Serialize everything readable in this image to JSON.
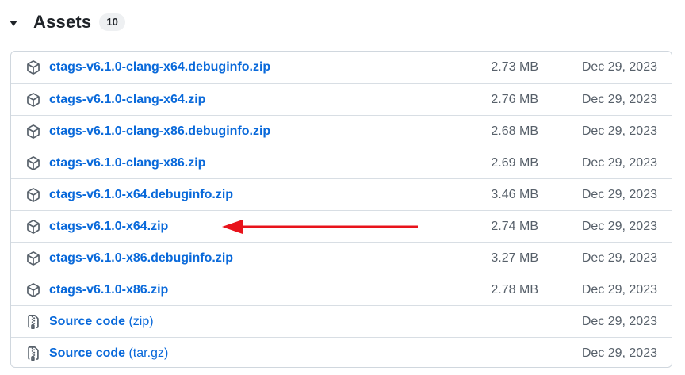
{
  "header": {
    "title": "Assets",
    "count": "10"
  },
  "assets": [
    {
      "name": "ctags-v6.1.0-clang-x64.debuginfo.zip",
      "suffix": "",
      "size": "2.73 MB",
      "date": "Dec 29, 2023",
      "icon": "package-icon"
    },
    {
      "name": "ctags-v6.1.0-clang-x64.zip",
      "suffix": "",
      "size": "2.76 MB",
      "date": "Dec 29, 2023",
      "icon": "package-icon"
    },
    {
      "name": "ctags-v6.1.0-clang-x86.debuginfo.zip",
      "suffix": "",
      "size": "2.68 MB",
      "date": "Dec 29, 2023",
      "icon": "package-icon"
    },
    {
      "name": "ctags-v6.1.0-clang-x86.zip",
      "suffix": "",
      "size": "2.69 MB",
      "date": "Dec 29, 2023",
      "icon": "package-icon"
    },
    {
      "name": "ctags-v6.1.0-x64.debuginfo.zip",
      "suffix": "",
      "size": "3.46 MB",
      "date": "Dec 29, 2023",
      "icon": "package-icon"
    },
    {
      "name": "ctags-v6.1.0-x64.zip",
      "suffix": "",
      "size": "2.74 MB",
      "date": "Dec 29, 2023",
      "icon": "package-icon"
    },
    {
      "name": "ctags-v6.1.0-x86.debuginfo.zip",
      "suffix": "",
      "size": "3.27 MB",
      "date": "Dec 29, 2023",
      "icon": "package-icon"
    },
    {
      "name": "ctags-v6.1.0-x86.zip",
      "suffix": "",
      "size": "2.78 MB",
      "date": "Dec 29, 2023",
      "icon": "package-icon"
    },
    {
      "name": "Source code",
      "suffix": " (zip)",
      "size": "",
      "date": "Dec 29, 2023",
      "icon": "file-zip-icon"
    },
    {
      "name": "Source code",
      "suffix": " (tar.gz)",
      "size": "",
      "date": "Dec 29, 2023",
      "icon": "file-zip-icon"
    }
  ],
  "annotation": {
    "color": "#e8131b"
  }
}
